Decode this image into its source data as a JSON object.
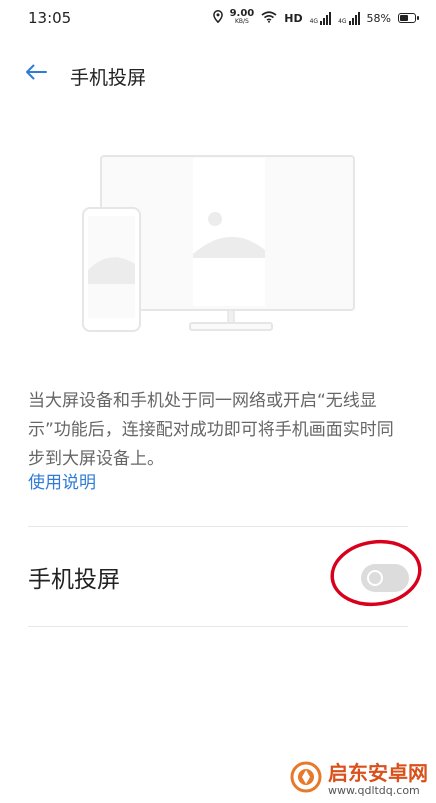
{
  "status_bar": {
    "time": "13:05",
    "net_speed_value": "9.00",
    "net_speed_unit": "KB/S",
    "hd_label": "HD",
    "signal1_label": "4G",
    "signal2_label": "4G",
    "battery_text": "58%",
    "battery_level": 0.58
  },
  "header": {
    "title": "手机投屏"
  },
  "main": {
    "description": "当大屏设备和手机处于同一网络或开启“无线显示”功能后，连接配对成功即可将手机画面实时同步到大屏设备上。",
    "help_link": "使用说明"
  },
  "setting": {
    "label": "手机投屏",
    "enabled": false
  },
  "annotation": {
    "highlight_color": "#d8001c"
  },
  "watermark": {
    "main_text": "启东安卓网",
    "url_text": "www.qdltdq.com"
  },
  "colors": {
    "accent": "#2f7bd6",
    "toggle_off": "#dcdcdc"
  }
}
